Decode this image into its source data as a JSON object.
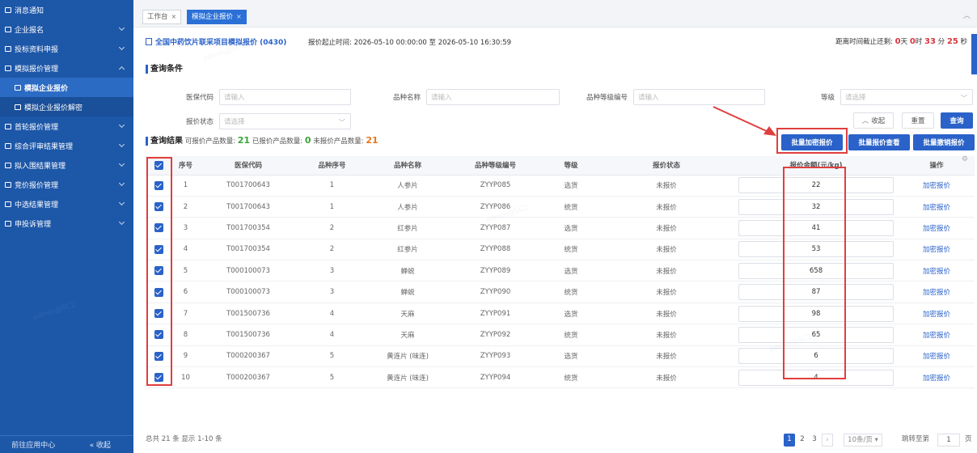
{
  "sidebar": {
    "items": [
      {
        "label": "消息通知"
      },
      {
        "label": "企业报名"
      },
      {
        "label": "投标资料申报"
      },
      {
        "label": "模拟报价管理"
      },
      {
        "label": "模拟企业报价"
      },
      {
        "label": "模拟企业报价解密"
      },
      {
        "label": "首轮报价管理"
      },
      {
        "label": "综合评审结果管理"
      },
      {
        "label": "拟入围结果管理"
      },
      {
        "label": "竞价报价管理"
      },
      {
        "label": "中选结果管理"
      },
      {
        "label": "申投诉管理"
      }
    ],
    "footer_left": "前往应用中心",
    "footer_right": "« 收起"
  },
  "tabs": [
    {
      "label": "工作台"
    },
    {
      "label": "模拟企业报价"
    }
  ],
  "project": {
    "title": "全国中药饮片联采项目模拟报价 (0430)",
    "time_range": "报价起止时间: 2026-05-10 00:00:00 至 2026-05-10 16:30:59",
    "countdown_prefix": "距离时间截止还剩: ",
    "days": "0",
    "days_unit": "天",
    "hours": "0",
    "hours_unit": "时",
    "minutes": "33",
    "minutes_unit": "分",
    "seconds": "25",
    "seconds_unit": "秒"
  },
  "query": {
    "section_title": "查询条件",
    "fields": {
      "medical_code": {
        "label": "医保代码",
        "placeholder": "请输入"
      },
      "variety_name": {
        "label": "品种名称",
        "placeholder": "请输入"
      },
      "grade_code": {
        "label": "品种等级编号",
        "placeholder": "请输入"
      },
      "grade": {
        "label": "等级",
        "placeholder": "请选择"
      },
      "status": {
        "label": "报价状态",
        "placeholder": "请选择"
      }
    },
    "collapse_label": "收起",
    "reset_label": "重置",
    "search_label": "查询"
  },
  "results": {
    "section_title": "查询结果",
    "can_label": "可报价产品数量: ",
    "can_count": "21",
    "quoted_label": "已报价产品数量: ",
    "quoted_count": "0",
    "unquoted_label": "未报价产品数量: ",
    "unquoted_count": "21",
    "btn_batch_encrypt": "批量加密报价",
    "btn_batch_view": "批量报价查看",
    "btn_batch_revoke": "批量撤销报价"
  },
  "table": {
    "headers": [
      "序号",
      "医保代码",
      "品种序号",
      "品种名称",
      "品种等级编号",
      "等级",
      "报价状态",
      "报价金额(元/kg)",
      "操作"
    ],
    "rows": [
      {
        "no": "1",
        "code": "T001700643",
        "vno": "1",
        "name": "人参片",
        "gcode": "ZYYP085",
        "grade": "选货",
        "status": "未报价",
        "amount": "22",
        "action": "加密报价"
      },
      {
        "no": "2",
        "code": "T001700643",
        "vno": "1",
        "name": "人参片",
        "gcode": "ZYYP086",
        "grade": "统货",
        "status": "未报价",
        "amount": "32",
        "action": "加密报价"
      },
      {
        "no": "3",
        "code": "T001700354",
        "vno": "2",
        "name": "红参片",
        "gcode": "ZYYP087",
        "grade": "选货",
        "status": "未报价",
        "amount": "41",
        "action": "加密报价"
      },
      {
        "no": "4",
        "code": "T001700354",
        "vno": "2",
        "name": "红参片",
        "gcode": "ZYYP088",
        "grade": "统货",
        "status": "未报价",
        "amount": "53",
        "action": "加密报价"
      },
      {
        "no": "5",
        "code": "T000100073",
        "vno": "3",
        "name": "蝉蜕",
        "gcode": "ZYYP089",
        "grade": "选货",
        "status": "未报价",
        "amount": "658",
        "action": "加密报价"
      },
      {
        "no": "6",
        "code": "T000100073",
        "vno": "3",
        "name": "蝉蜕",
        "gcode": "ZYYP090",
        "grade": "统货",
        "status": "未报价",
        "amount": "87",
        "action": "加密报价"
      },
      {
        "no": "7",
        "code": "T001500736",
        "vno": "4",
        "name": "天麻",
        "gcode": "ZYYP091",
        "grade": "选货",
        "status": "未报价",
        "amount": "98",
        "action": "加密报价"
      },
      {
        "no": "8",
        "code": "T001500736",
        "vno": "4",
        "name": "天麻",
        "gcode": "ZYYP092",
        "grade": "统货",
        "status": "未报价",
        "amount": "65",
        "action": "加密报价"
      },
      {
        "no": "9",
        "code": "T000200367",
        "vno": "5",
        "name": "黄连片 (味连)",
        "gcode": "ZYYP093",
        "grade": "选货",
        "status": "未报价",
        "amount": "6",
        "action": "加密报价"
      },
      {
        "no": "10",
        "code": "T000200367",
        "vno": "5",
        "name": "黄连片 (味连)",
        "gcode": "ZYYP094",
        "grade": "统货",
        "status": "未报价",
        "amount": "4",
        "action": "加密报价"
      }
    ]
  },
  "pagination": {
    "summary": "总共 21 条 显示 1-10 条",
    "pages": [
      "1",
      "2",
      "3"
    ],
    "current": "1",
    "page_size": "10条/页",
    "jump_label": "跳转至第",
    "jump_value": "1",
    "jump_suffix": "页"
  },
  "colors": {
    "sidebar_bg": "#1d57a8",
    "primary": "#2a62c9",
    "green_count": "#3aa33a",
    "orange_count": "#e8741c",
    "countdown_red": "#d9363e",
    "highlight_red": "#e03e3e"
  }
}
